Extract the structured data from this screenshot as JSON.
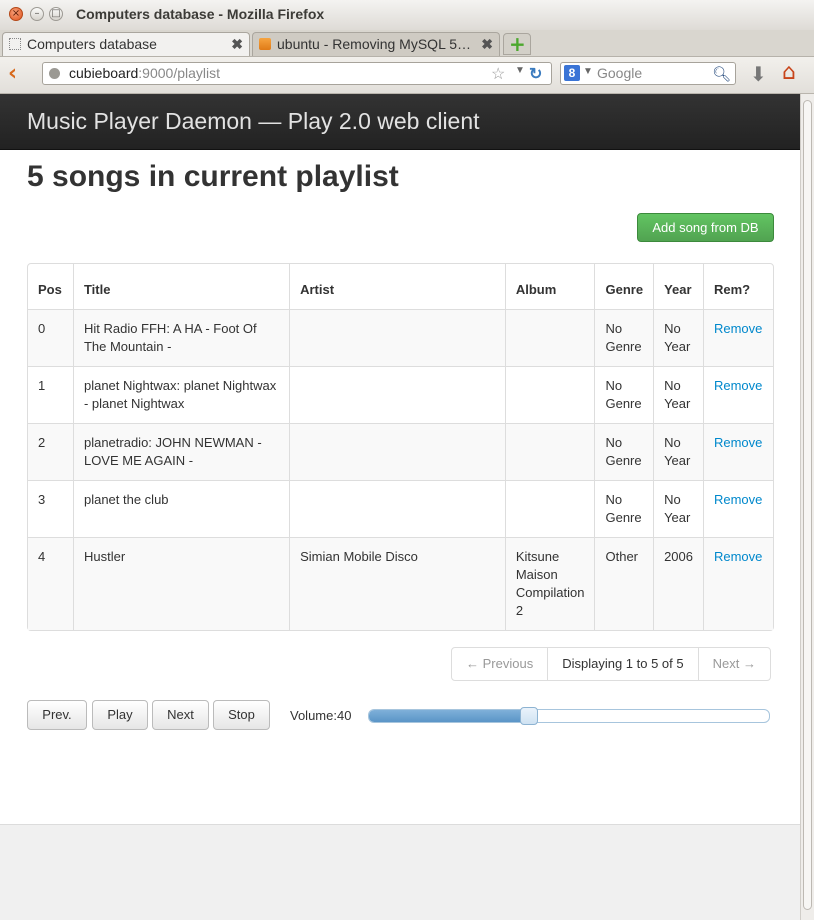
{
  "window": {
    "title": "Computers database - Mozilla Firefox"
  },
  "tabs": [
    {
      "label": "Computers database",
      "active": true
    },
    {
      "label": "ubuntu - Removing MySQL 5…",
      "active": false
    }
  ],
  "navbar": {
    "url_host": "cubieboard",
    "url_path": ":9000/playlist",
    "search_engine": "8",
    "search_placeholder": "Google"
  },
  "header": {
    "brand": "Music Player Daemon — Play 2.0 web client"
  },
  "page": {
    "title": "5 songs in current playlist",
    "add_button": "Add song from DB"
  },
  "table": {
    "columns": [
      "Pos",
      "Title",
      "Artist",
      "Album",
      "Genre",
      "Year",
      "Rem?"
    ],
    "rows": [
      {
        "pos": "0",
        "title": "Hit Radio FFH: A HA - Foot Of The Mountain -",
        "artist": "",
        "album": "",
        "genre": "No Genre",
        "year": "No Year",
        "remove": "Remove"
      },
      {
        "pos": "1",
        "title": "planet Nightwax: planet Nightwax - planet Nightwax",
        "artist": "",
        "album": "",
        "genre": "No Genre",
        "year": "No Year",
        "remove": "Remove"
      },
      {
        "pos": "2",
        "title": "planetradio: JOHN NEWMAN - LOVE ME AGAIN -",
        "artist": "",
        "album": "",
        "genre": "No Genre",
        "year": "No Year",
        "remove": "Remove"
      },
      {
        "pos": "3",
        "title": "planet the club",
        "artist": "",
        "album": "",
        "genre": "No Genre",
        "year": "No Year",
        "remove": "Remove"
      },
      {
        "pos": "4",
        "title": "Hustler",
        "artist": "Simian Mobile Disco",
        "album": "Kitsune Maison Compilation 2",
        "genre": "Other",
        "year": "2006",
        "remove": "Remove"
      }
    ]
  },
  "pagination": {
    "previous": "← Previous",
    "info": "Displaying 1 to 5 of 5",
    "next": "Next →"
  },
  "controls": {
    "prev": "Prev.",
    "play": "Play",
    "next": "Next",
    "stop": "Stop",
    "volume_label": "Volume:40",
    "volume_fraction": 0.4
  }
}
